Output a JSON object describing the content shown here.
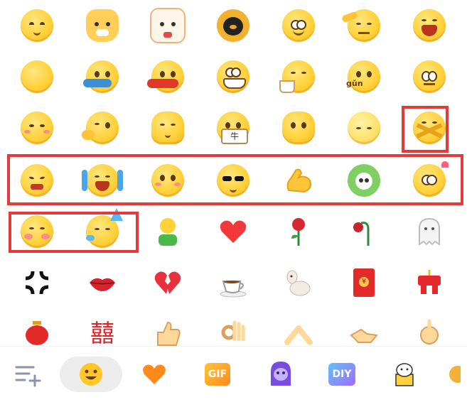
{
  "emoji_panel": {
    "rows": [
      [
        "smile-face",
        "cat-smirk",
        "lucky-cat",
        "ox-penguin",
        "grin-face",
        "salute-face",
        "laugh-face"
      ],
      [
        "blank-face",
        "fish-face",
        "red-fish-face",
        "teeth-grin",
        "tea-face",
        "gun-face",
        "shiver-face"
      ],
      [
        "hug-face",
        "ok-face",
        "shrug-face",
        "niu-fan-face",
        "shy-face",
        "hair-face",
        "arms-crossed"
      ],
      [
        "wince-face",
        "cry-laugh",
        "blush-face",
        "cool-face",
        "strong-arm",
        "cabbage-dog",
        "dazed-face"
      ],
      [
        "blush-cute",
        "party-face",
        "green-man",
        "heart",
        "rose",
        "wilted-rose",
        "ghost"
      ],
      [
        "anger-symbol",
        "lips",
        "broken-heart",
        "coffee",
        "alpaca",
        "red-envelope",
        "firecracker"
      ],
      [
        "lantern",
        "double-happiness",
        "thumbs-up",
        "ok-hand",
        "pointing-hands",
        "handshake",
        "hand-gesture"
      ]
    ],
    "texts": {
      "niu": "牛",
      "gun": "gǔn",
      "red_envelope": "¥",
      "double_happiness": "囍"
    }
  },
  "highlights": [
    "box-arms-crossed",
    "box-row-4",
    "box-row-5"
  ],
  "tabbar": {
    "tabs": [
      {
        "name": "manage-icon",
        "active": false
      },
      {
        "name": "emoji-tab-icon",
        "active": true
      },
      {
        "name": "favorites-heart-icon",
        "active": false
      },
      {
        "name": "gif-tab-icon",
        "active": false
      },
      {
        "name": "ghost-sticker-icon",
        "active": false
      },
      {
        "name": "diy-tab-icon",
        "active": false
      },
      {
        "name": "cat-gift-icon",
        "active": false
      }
    ],
    "gif_label": "GIF",
    "diy_label": "DIY"
  },
  "colors": {
    "highlight": "#e53a3a",
    "active_tab_bg": "#ededed",
    "emoji_yellow": "#ffd23c"
  }
}
